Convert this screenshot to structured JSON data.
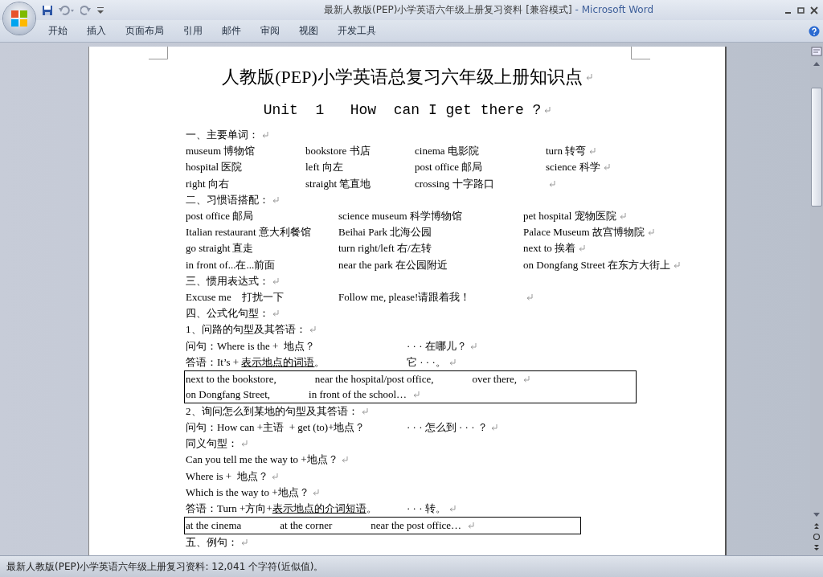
{
  "window": {
    "title": "最新人教版(PEP)小学英语六年级上册复习资料 [兼容模式]",
    "app_name": "- Microsoft Word"
  },
  "ribbon_tabs": [
    "开始",
    "插入",
    "页面布局",
    "引用",
    "邮件",
    "审阅",
    "视图",
    "开发工具"
  ],
  "document": {
    "lines": [
      {
        "kind": "title",
        "cells": [
          {
            "text": "人教版(PEP)小学英语总复习六年级上册知识点"
          }
        ],
        "paragraph_mark": true
      },
      {
        "kind": "unit",
        "cells": [
          {
            "text": "Unit  1   How  can I get there ?"
          }
        ],
        "paragraph_mark": true
      },
      {
        "kind": "text",
        "cells": [
          {
            "text": "一、主要单词："
          }
        ],
        "paragraph_mark": true
      },
      {
        "kind": "words",
        "cells": [
          {
            "text": "museum 博物馆"
          },
          {
            "text": "bookstore 书店"
          },
          {
            "text": "cinema 电影院"
          },
          {
            "text": "turn 转弯"
          }
        ],
        "paragraph_mark": true
      },
      {
        "kind": "words",
        "cells": [
          {
            "text": "hospital 医院"
          },
          {
            "text": "left 向左"
          },
          {
            "text": "post office 邮局"
          },
          {
            "text": "science 科学"
          }
        ],
        "paragraph_mark": true
      },
      {
        "kind": "words",
        "cells": [
          {
            "text": "right 向右"
          },
          {
            "text": "straight 笔直地"
          },
          {
            "text": "crossing 十字路口"
          }
        ],
        "paragraph_mark": true
      },
      {
        "kind": "text",
        "cells": [
          {
            "text": "二、习惯语搭配："
          }
        ],
        "paragraph_mark": true
      },
      {
        "kind": "phrases",
        "cells": [
          {
            "text": "post office 邮局"
          },
          {
            "text": "science museum 科学博物馆"
          },
          {
            "text": "pet hospital 宠物医院"
          }
        ],
        "paragraph_mark": true
      },
      {
        "kind": "phrases",
        "cells": [
          {
            "text": "Italian restaurant 意大利餐馆"
          },
          {
            "text": "Beihai Park 北海公园"
          },
          {
            "text": "Palace Museum 故宫博物院"
          }
        ],
        "paragraph_mark": true
      },
      {
        "kind": "phrases",
        "cells": [
          {
            "text": "go straight 直走"
          },
          {
            "text": "turn right/left 右/左转"
          },
          {
            "text": "next to 挨着"
          }
        ],
        "paragraph_mark": true
      },
      {
        "kind": "phrases",
        "cells": [
          {
            "text": "in front of...在...前面"
          },
          {
            "text": "near the park 在公园附近"
          },
          {
            "text": "on Dongfang Street 在东方大街上"
          }
        ],
        "paragraph_mark": true
      },
      {
        "kind": "text",
        "cells": [
          {
            "text": "三、惯用表达式："
          }
        ],
        "paragraph_mark": true
      },
      {
        "kind": "phrases",
        "cells": [
          {
            "text": "Excuse me　打扰一下"
          },
          {
            "text": "Follow me, please!请跟着我！"
          }
        ],
        "paragraph_mark": true
      },
      {
        "kind": "text",
        "cells": [
          {
            "text": "四、公式化句型："
          }
        ],
        "paragraph_mark": true
      },
      {
        "kind": "text",
        "cells": [
          {
            "text": "1、问路的句型及其答语："
          }
        ],
        "paragraph_mark": true
      },
      {
        "kind": "pair",
        "cells": [
          {
            "text": "问句：Where is the +  地点？"
          },
          {
            "text": "· · · 在哪儿？"
          }
        ],
        "paragraph_mark": true
      },
      {
        "kind": "pair",
        "cells": [
          {
            "segments": [
              {
                "text": "答语：It’s + ",
                "underline": false
              },
              {
                "text": "表示地点的词语",
                "underline": true
              },
              {
                "text": "。",
                "underline": false
              }
            ]
          },
          {
            "text": "它 · · ·。"
          }
        ],
        "paragraph_mark": true
      },
      {
        "kind": "box",
        "rows": [
          {
            "cells": [
              {
                "text": "next to the bookstore,"
              },
              {
                "text": "near the hospital/post office,"
              },
              {
                "text": "over there,"
              }
            ],
            "paragraph_mark": true
          },
          {
            "cells": [
              {
                "text": "on Dongfang Street,"
              },
              {
                "text": "in front of the school…"
              }
            ],
            "paragraph_mark": true
          }
        ]
      },
      {
        "kind": "text",
        "cells": [
          {
            "text": "2、询问怎么到某地的句型及其答语："
          }
        ],
        "paragraph_mark": true
      },
      {
        "kind": "pair",
        "cells": [
          {
            "text": "问句：How can +主语  + get (to)+地点？"
          },
          {
            "text": "· · · 怎么到 · · · ？"
          }
        ],
        "paragraph_mark": true
      },
      {
        "kind": "text",
        "cells": [
          {
            "text": "同义句型："
          }
        ],
        "paragraph_mark": true
      },
      {
        "kind": "text",
        "cells": [
          {
            "text": "Can you tell me the way to +地点？"
          }
        ],
        "paragraph_mark": true
      },
      {
        "kind": "text",
        "cells": [
          {
            "text": "Where is +  地点？"
          }
        ],
        "paragraph_mark": true
      },
      {
        "kind": "text",
        "cells": [
          {
            "text": "Which is the way to +地点？"
          }
        ],
        "paragraph_mark": true
      },
      {
        "kind": "pair",
        "cells": [
          {
            "segments": [
              {
                "text": "答语：Turn +方向+",
                "underline": false
              },
              {
                "text": "表示地点的介词短语",
                "underline": true
              },
              {
                "text": "。",
                "underline": false
              }
            ]
          },
          {
            "text": "· · · 转。"
          }
        ],
        "paragraph_mark": true
      },
      {
        "kind": "box",
        "rows": [
          {
            "cells": [
              {
                "text": "at the cinema"
              },
              {
                "text": "at the corner"
              },
              {
                "text": "near the post office…"
              }
            ],
            "paragraph_mark": true
          }
        ]
      },
      {
        "kind": "text",
        "cells": [
          {
            "text": "五、例句："
          }
        ],
        "paragraph_mark": true
      }
    ]
  },
  "status_bar": {
    "text": "最新人教版(PEP)小学英语六年级上册复习资料: 12,041 个字符(近似值)。"
  }
}
